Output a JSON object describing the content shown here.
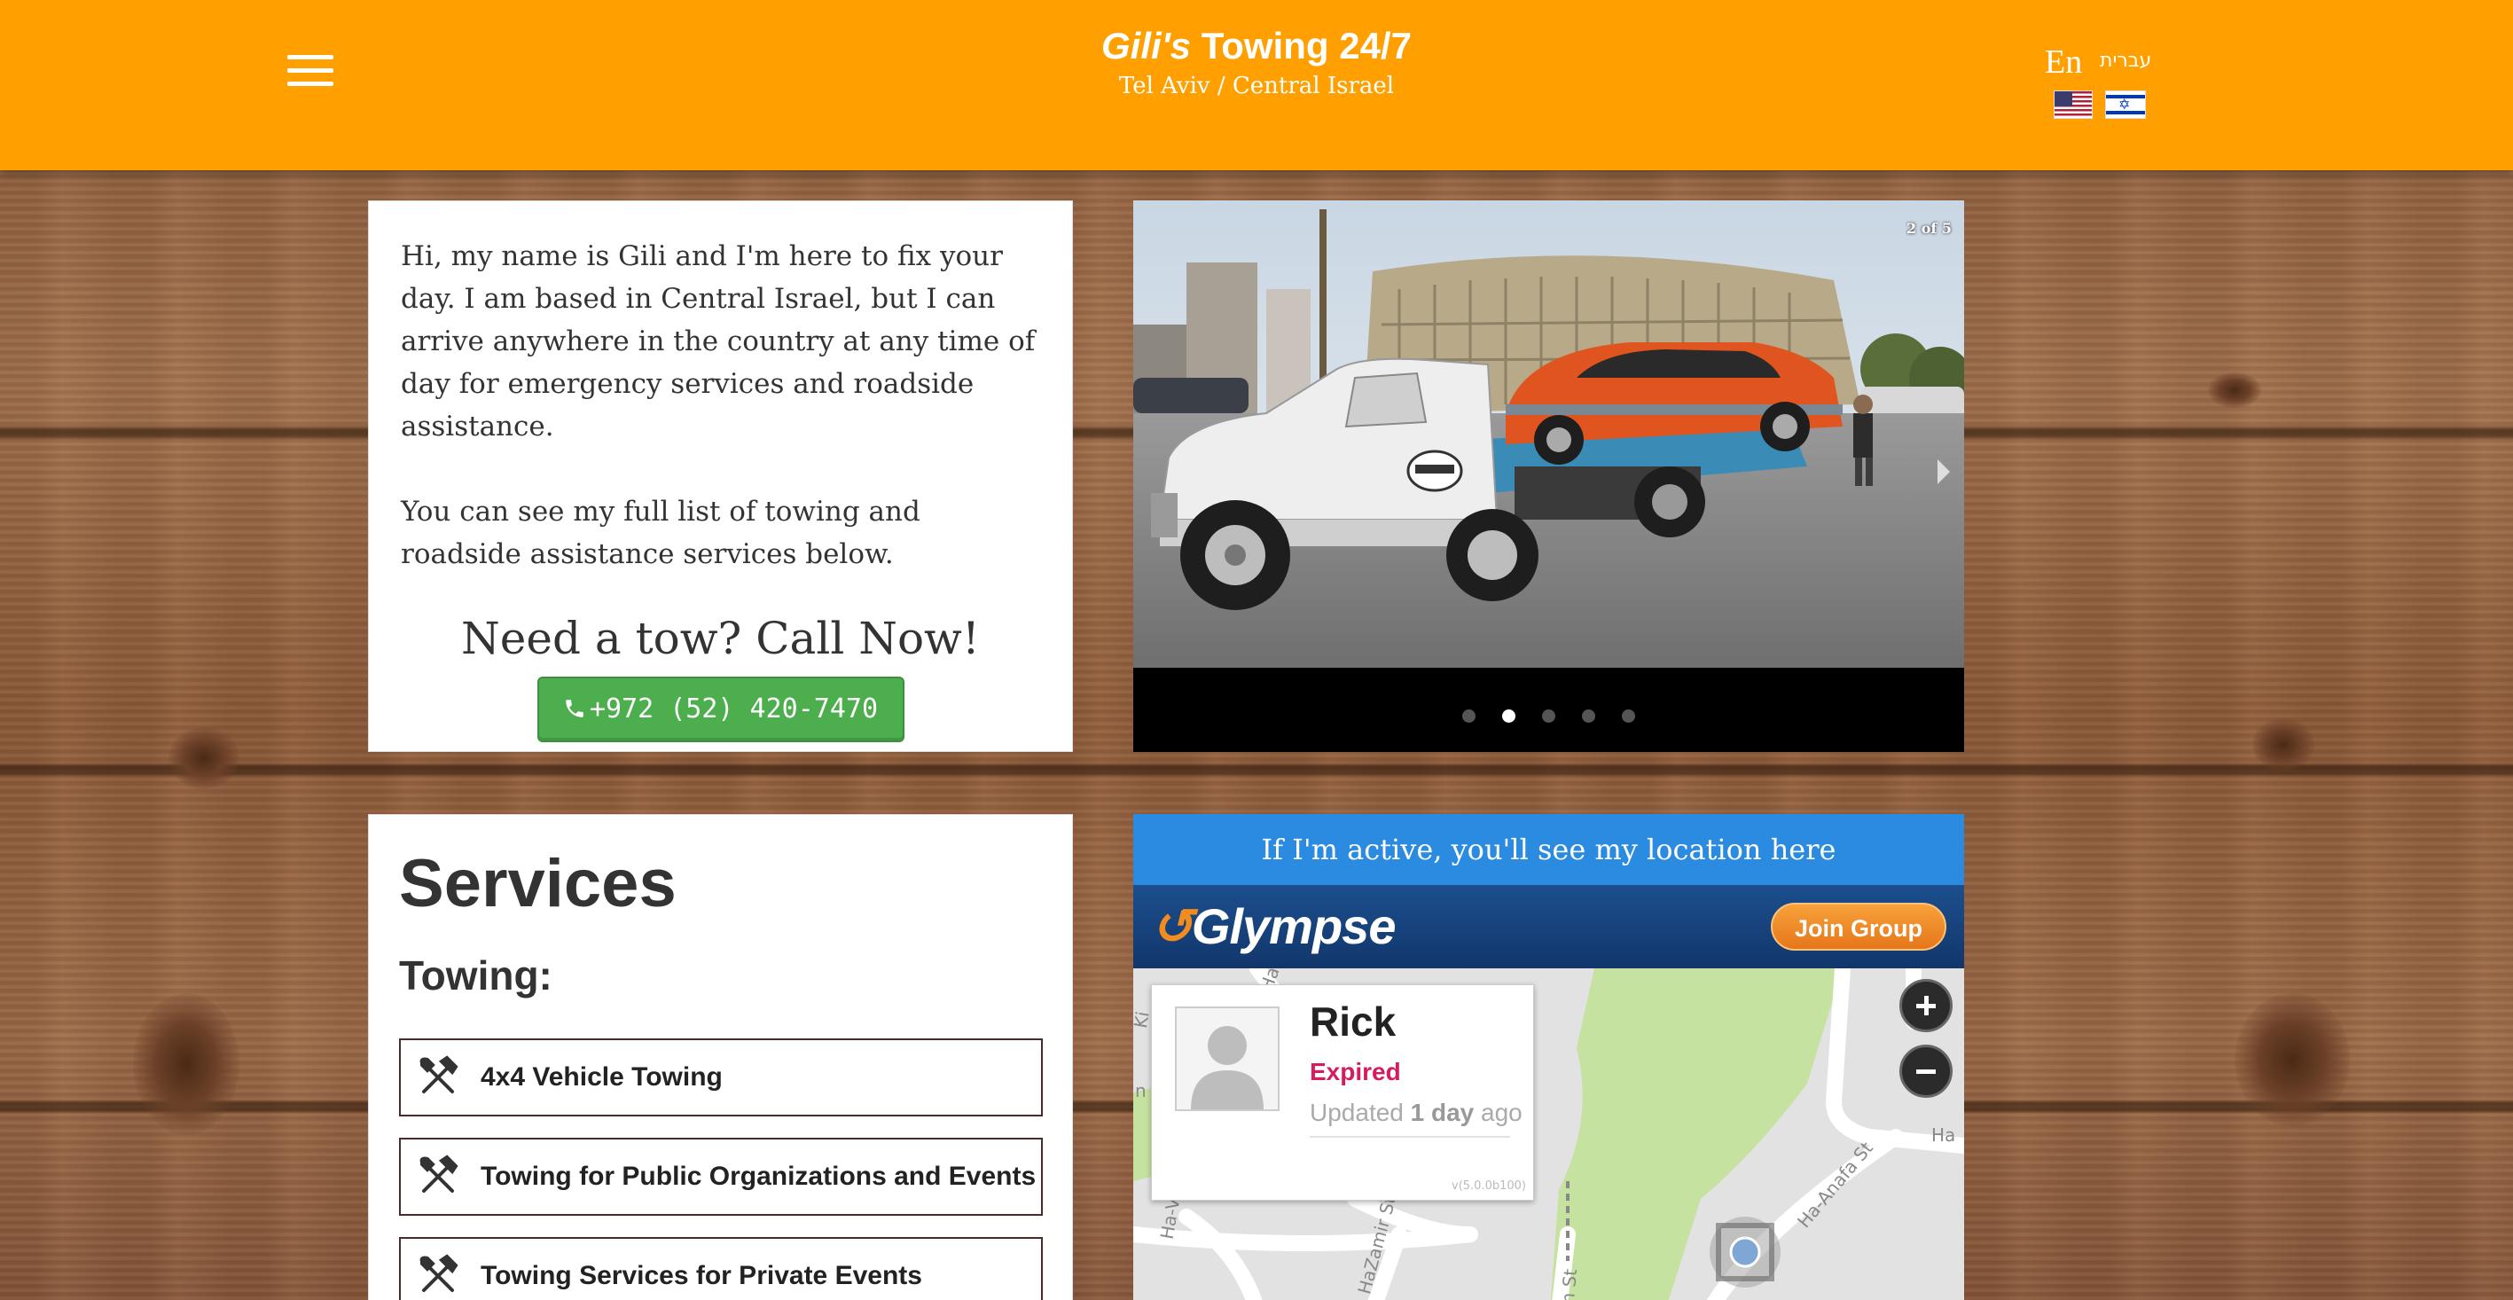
{
  "header": {
    "title_name": "Gili's",
    "title_rest": " Towing 24/7",
    "subtitle": "Tel Aviv / Central Israel",
    "lang_en": "En",
    "lang_he": "עברית"
  },
  "intro": {
    "paragraph1": "Hi, my name is Gili and I'm here to fix your day. I am based in Central Israel, but I can arrive anywhere in the country at any time of day for emergency services and roadside assistance.",
    "paragraph2": "You can see my full list of towing and roadside assistance services below.",
    "cta_heading": "Need a tow? Call Now!",
    "phone": "+972 (52) 420-7470"
  },
  "slider": {
    "counter": "2 of 5",
    "slide_count": 5,
    "active_index": 1
  },
  "services": {
    "title": "Services",
    "towing_heading": "Towing:",
    "items": [
      "4x4 Vehicle Towing",
      "Towing for Public Organizations and Events",
      "Towing Services for Private Events"
    ]
  },
  "location": {
    "banner": "If I'm active, you'll see my location here",
    "glympse_brand": "Glympse",
    "join_label": "Join Group",
    "user_name": "Rick",
    "status": "Expired",
    "updated_prefix": "Updated ",
    "updated_bold": "1 day",
    "updated_suffix": " ago",
    "version": "v(5.0.0b100)",
    "streets": [
      "Ha-Anafa St",
      "HaZamir St",
      "Ha-V",
      "Ha",
      "Ha",
      "m St",
      "Ki",
      "n"
    ]
  },
  "colors": {
    "header_bg": "#ffa000",
    "call_button": "#4cae4c",
    "banner_blue": "#2a8be0",
    "expired_red": "#d81b60",
    "join_orange": "#e5761a"
  }
}
